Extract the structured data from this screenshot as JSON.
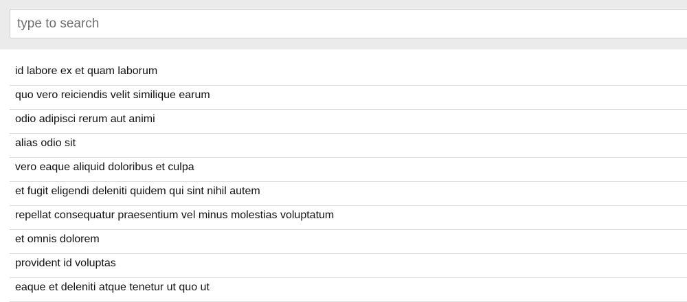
{
  "search": {
    "placeholder": "type to search",
    "value": ""
  },
  "results": [
    "id labore ex et quam laborum",
    "quo vero reiciendis velit similique earum",
    "odio adipisci rerum aut animi",
    "alias odio sit",
    "vero eaque aliquid doloribus et culpa",
    "et fugit eligendi deleniti quidem qui sint nihil autem",
    "repellat consequatur praesentium vel minus molestias voluptatum",
    "et omnis dolorem",
    "provident id voluptas",
    "eaque et deleniti atque tenetur ut quo ut"
  ]
}
